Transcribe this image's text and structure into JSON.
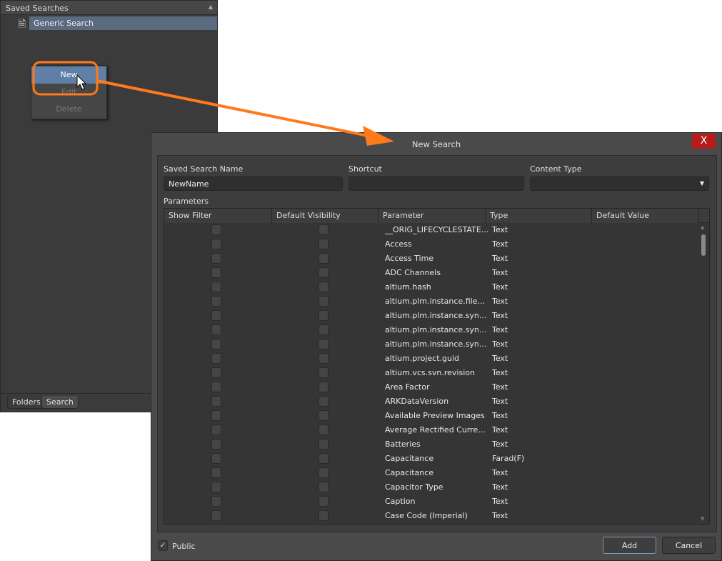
{
  "left_panel": {
    "title": "Saved Searches",
    "items": [
      {
        "label": "Generic Search",
        "icon": "document-icon"
      }
    ],
    "context_menu": [
      {
        "label": "New",
        "state": "highlighted"
      },
      {
        "label": "Edit",
        "state": "disabled"
      },
      {
        "label": "Delete",
        "state": "disabled"
      }
    ],
    "tabs": [
      {
        "label": "Folders"
      },
      {
        "label": "Search",
        "active": true
      }
    ]
  },
  "dialog": {
    "title": "New Search",
    "close_label": "X",
    "fields": {
      "name_label": "Saved Search Name",
      "name_value": "NewName",
      "shortcut_label": "Shortcut",
      "shortcut_value": "",
      "content_type_label": "Content Type",
      "content_type_value": ""
    },
    "parameters_label": "Parameters",
    "columns": [
      "Show Filter",
      "Default Visibility",
      "Parameter",
      "Type",
      "Default Value"
    ],
    "rows": [
      {
        "param": "__ORIG_LIFECYCLESTATE...",
        "type": "Text",
        "show_filter": false,
        "default_visibility": false
      },
      {
        "param": "Access",
        "type": "Text",
        "show_filter": false,
        "default_visibility": false
      },
      {
        "param": "Access Time",
        "type": "Text",
        "show_filter": false,
        "default_visibility": false
      },
      {
        "param": "ADC Channels",
        "type": "Text",
        "show_filter": false,
        "default_visibility": false
      },
      {
        "param": "altium.hash",
        "type": "Text",
        "show_filter": false,
        "default_visibility": false
      },
      {
        "param": "altium.plm.instance.file...",
        "type": "Text",
        "show_filter": false,
        "default_visibility": false
      },
      {
        "param": "altium.plm.instance.syn...",
        "type": "Text",
        "show_filter": false,
        "default_visibility": false
      },
      {
        "param": "altium.plm.instance.syn...",
        "type": "Text",
        "show_filter": false,
        "default_visibility": false
      },
      {
        "param": "altium.plm.instance.syn...",
        "type": "Text",
        "show_filter": false,
        "default_visibility": false
      },
      {
        "param": "altium.project.guid",
        "type": "Text",
        "show_filter": false,
        "default_visibility": false
      },
      {
        "param": "altium.vcs.svn.revision",
        "type": "Text",
        "show_filter": false,
        "default_visibility": false
      },
      {
        "param": "Area Factor",
        "type": "Text",
        "show_filter": false,
        "default_visibility": false
      },
      {
        "param": "ARKDataVersion",
        "type": "Text",
        "show_filter": false,
        "default_visibility": false
      },
      {
        "param": "Available Preview Images",
        "type": "Text",
        "show_filter": false,
        "default_visibility": false
      },
      {
        "param": "Average Rectified Curre...",
        "type": "Text",
        "show_filter": false,
        "default_visibility": false
      },
      {
        "param": "Batteries",
        "type": "Text",
        "show_filter": false,
        "default_visibility": false
      },
      {
        "param": "Capacitance",
        "type": "Farad(F)",
        "show_filter": false,
        "default_visibility": false
      },
      {
        "param": "Capacitance",
        "type": "Text",
        "show_filter": false,
        "default_visibility": false
      },
      {
        "param": "Capacitor Type",
        "type": "Text",
        "show_filter": false,
        "default_visibility": false
      },
      {
        "param": "Caption",
        "type": "Text",
        "show_filter": false,
        "default_visibility": false
      },
      {
        "param": "Case Code (Imperial)",
        "type": "Text",
        "show_filter": false,
        "default_visibility": false
      }
    ],
    "public_label": "Public",
    "public_checked": true,
    "add_label": "Add",
    "cancel_label": "Cancel"
  },
  "colors": {
    "accent_orange": "#ff7a1a",
    "close_red": "#b71c1c",
    "selection_blue": "#5f7fa6"
  }
}
